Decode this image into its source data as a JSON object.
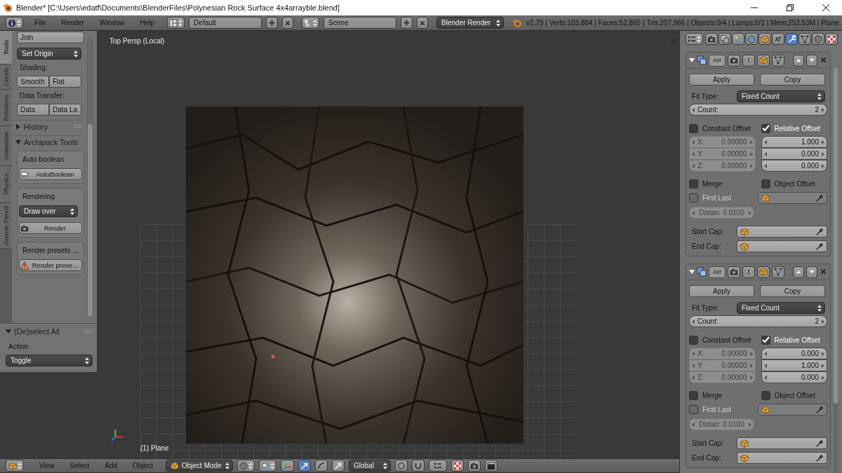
{
  "window": {
    "title": "Blender* [C:\\Users\\edatf\\Documents\\BlenderFiles\\Polynesian Rock Surface 4x4arrayble.blend]"
  },
  "top_header": {
    "menus": [
      "File",
      "Render",
      "Window",
      "Help"
    ],
    "screen_layout": "Default",
    "scene": "Scene",
    "render_engine": "Blender Render",
    "stats": "v2.79 | Verts:103,884 | Faces:52,865 | Tris:207,966 | Objects:0/4 | Lamps:0/1 | Mem:253.53M | Plane"
  },
  "tool_tabs": [
    {
      "label": "Tools",
      "selected": true
    },
    {
      "label": "Create",
      "selected": false
    },
    {
      "label": "Relations",
      "selected": false
    },
    {
      "label": "Animation",
      "selected": false
    },
    {
      "label": "Physics",
      "selected": false
    },
    {
      "label": "Grease Pencil",
      "selected": false
    }
  ],
  "tool_panel": {
    "join": "Join",
    "set_origin": "Set Origin",
    "shading_label": "Shading:",
    "shading_buttons": [
      "Smooth",
      "Flat"
    ],
    "data_transfer_label": "Data Transfer:",
    "data_transfer_buttons": [
      "Data",
      "Data La"
    ],
    "sections": [
      {
        "title": "History",
        "expanded": false
      },
      {
        "title": "Archipack Tools",
        "expanded": true
      }
    ],
    "boxes": [
      {
        "title": "Auto boolean",
        "items": [
          {
            "kind": "button",
            "label": "AutoBoolean"
          }
        ]
      },
      {
        "title": "Rendering",
        "items": [
          {
            "kind": "dropdown",
            "label": "Draw over"
          },
          {
            "kind": "button",
            "label": "Render"
          }
        ]
      },
      {
        "title": "Render presets ...",
        "items": [
          {
            "kind": "button",
            "label": "Render prese..."
          }
        ]
      }
    ]
  },
  "operator_panel": {
    "title": "(De)select All",
    "expanded": true,
    "action_label": "Action",
    "action_value": "Toggle"
  },
  "viewport": {
    "view_label": "Top Persp (Local)",
    "object_label": "(1) Plane"
  },
  "bottom_header": {
    "menus": [
      "View",
      "Select",
      "Add",
      "Object"
    ],
    "mode": "Object Mode",
    "orientation": "Global"
  },
  "properties_tabs": [
    {
      "kind": "camera",
      "selected": false
    },
    {
      "kind": "layers",
      "selected": false
    },
    {
      "kind": "scene",
      "selected": false
    },
    {
      "kind": "world",
      "selected": false
    },
    {
      "kind": "cube",
      "selected": false
    },
    {
      "kind": "link",
      "selected": false
    },
    {
      "kind": "wrench",
      "selected": true
    },
    {
      "kind": "vertices",
      "selected": false
    },
    {
      "kind": "sphere",
      "selected": false
    },
    {
      "kind": "checker",
      "selected": false
    }
  ],
  "modifiers": [
    {
      "name": "Arr",
      "expanded": true,
      "apply": "Apply",
      "copy": "Copy",
      "fit_type_label": "Fit Type:",
      "fit_type": "Fixed Count",
      "count_label": "Count:",
      "count": "2",
      "constant_offset": {
        "label": "Constant Offset",
        "checked": false,
        "fields": [
          {
            "axis": "X:",
            "value": "0.00000"
          },
          {
            "axis": "Y:",
            "value": "0.00000"
          },
          {
            "axis": "Z:",
            "value": "0.00000"
          }
        ]
      },
      "relative_offset": {
        "label": "Relative Offset",
        "checked": true,
        "values": [
          "1.000",
          "0.000",
          "0.000"
        ]
      },
      "merge": {
        "label": "Merge",
        "checked": false
      },
      "object_offset": {
        "label": "Object Offset",
        "checked": false
      },
      "first_last": {
        "label": "First Last",
        "checked": false
      },
      "distance": "Distan: 0.0100",
      "start_cap_label": "Start Cap:",
      "end_cap_label": "End Cap:"
    },
    {
      "name": "Arr",
      "expanded": true,
      "apply": "Apply",
      "copy": "Copy",
      "fit_type_label": "Fit Type:",
      "fit_type": "Fixed Count",
      "count_label": "Count:",
      "count": "2",
      "constant_offset": {
        "label": "Constant Offset",
        "checked": false,
        "fields": [
          {
            "axis": "X:",
            "value": "0.00000"
          },
          {
            "axis": "Y:",
            "value": "0.00000"
          },
          {
            "axis": "Z:",
            "value": "0.00000"
          }
        ]
      },
      "relative_offset": {
        "label": "Relative Offset",
        "checked": true,
        "values": [
          "0.000",
          "1.000",
          "0.000"
        ]
      },
      "merge": {
        "label": "Merge",
        "checked": false
      },
      "object_offset": {
        "label": "Object Offset",
        "checked": false
      },
      "first_last": {
        "label": "First Last",
        "checked": false
      },
      "distance": "Distan: 0.0100",
      "start_cap_label": "Start Cap:",
      "end_cap_label": "End Cap:"
    }
  ]
}
